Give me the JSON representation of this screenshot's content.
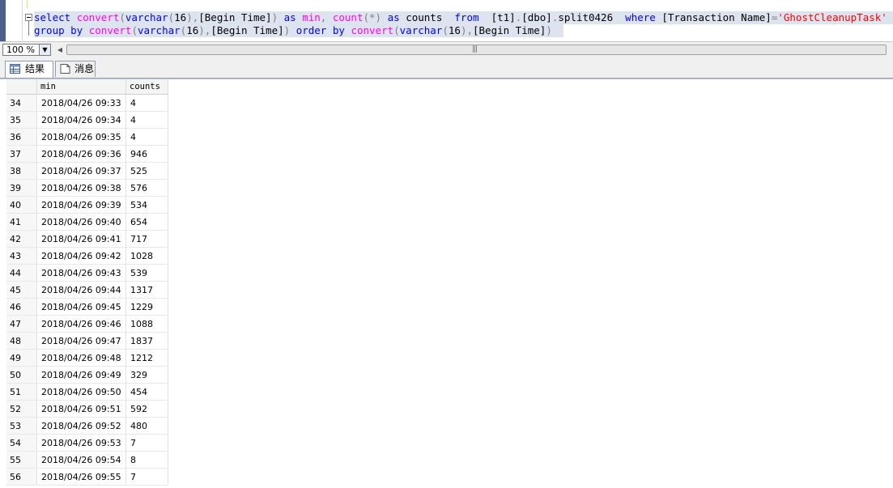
{
  "editor": {
    "line1": [
      {
        "c": "kw",
        "t": "select"
      },
      {
        "c": "tx",
        "t": " "
      },
      {
        "c": "fn",
        "t": "convert"
      },
      {
        "c": "gr",
        "t": "("
      },
      {
        "c": "kw",
        "t": "varchar"
      },
      {
        "c": "gr",
        "t": "("
      },
      {
        "c": "tx",
        "t": "16"
      },
      {
        "c": "gr",
        "t": "),"
      },
      {
        "c": "tx",
        "t": "[Begin Time]"
      },
      {
        "c": "gr",
        "t": ")"
      },
      {
        "c": "tx",
        "t": " "
      },
      {
        "c": "kw",
        "t": "as"
      },
      {
        "c": "tx",
        "t": " "
      },
      {
        "c": "fn",
        "t": "min"
      },
      {
        "c": "gr",
        "t": ","
      },
      {
        "c": "tx",
        "t": " "
      },
      {
        "c": "fn",
        "t": "count"
      },
      {
        "c": "gr",
        "t": "(*)"
      },
      {
        "c": "tx",
        "t": " "
      },
      {
        "c": "kw",
        "t": "as"
      },
      {
        "c": "tx",
        "t": " counts  "
      },
      {
        "c": "kw",
        "t": "from"
      },
      {
        "c": "tx",
        "t": "  [t1]"
      },
      {
        "c": "gr",
        "t": "."
      },
      {
        "c": "tx",
        "t": "[dbo]"
      },
      {
        "c": "gr",
        "t": "."
      },
      {
        "c": "tx",
        "t": "split0426  "
      },
      {
        "c": "kw",
        "t": "where"
      },
      {
        "c": "tx",
        "t": " [Transaction Name]"
      },
      {
        "c": "gr",
        "t": "="
      },
      {
        "c": "str",
        "t": "'GhostCleanupTask'"
      }
    ],
    "line2": [
      {
        "c": "kw",
        "t": "group by"
      },
      {
        "c": "tx",
        "t": " "
      },
      {
        "c": "fn",
        "t": "convert"
      },
      {
        "c": "gr",
        "t": "("
      },
      {
        "c": "kw",
        "t": "varchar"
      },
      {
        "c": "gr",
        "t": "("
      },
      {
        "c": "tx",
        "t": "16"
      },
      {
        "c": "gr",
        "t": "),"
      },
      {
        "c": "tx",
        "t": "[Begin Time]"
      },
      {
        "c": "gr",
        "t": ")"
      },
      {
        "c": "tx",
        "t": " "
      },
      {
        "c": "kw",
        "t": "order by"
      },
      {
        "c": "tx",
        "t": " "
      },
      {
        "c": "fn",
        "t": "convert"
      },
      {
        "c": "gr",
        "t": "("
      },
      {
        "c": "kw",
        "t": "varchar"
      },
      {
        "c": "gr",
        "t": "("
      },
      {
        "c": "tx",
        "t": "16"
      },
      {
        "c": "gr",
        "t": "),"
      },
      {
        "c": "tx",
        "t": "[Begin Time]"
      },
      {
        "c": "gr",
        "t": ")"
      }
    ]
  },
  "zoom": {
    "value": "100 %"
  },
  "scrollbar": {
    "grip": "|||"
  },
  "tabs": {
    "results": "结果",
    "messages": "消息"
  },
  "grid": {
    "columns": [
      "min",
      "counts"
    ],
    "rows": [
      [
        "34",
        "2018/04/26 09:33",
        "4"
      ],
      [
        "35",
        "2018/04/26 09:34",
        "4"
      ],
      [
        "36",
        "2018/04/26 09:35",
        "4"
      ],
      [
        "37",
        "2018/04/26 09:36",
        "946"
      ],
      [
        "38",
        "2018/04/26 09:37",
        "525"
      ],
      [
        "39",
        "2018/04/26 09:38",
        "576"
      ],
      [
        "40",
        "2018/04/26 09:39",
        "534"
      ],
      [
        "41",
        "2018/04/26 09:40",
        "654"
      ],
      [
        "42",
        "2018/04/26 09:41",
        "717"
      ],
      [
        "43",
        "2018/04/26 09:42",
        "1028"
      ],
      [
        "44",
        "2018/04/26 09:43",
        "539"
      ],
      [
        "45",
        "2018/04/26 09:44",
        "1317"
      ],
      [
        "46",
        "2018/04/26 09:45",
        "1229"
      ],
      [
        "47",
        "2018/04/26 09:46",
        "1088"
      ],
      [
        "48",
        "2018/04/26 09:47",
        "1837"
      ],
      [
        "49",
        "2018/04/26 09:48",
        "1212"
      ],
      [
        "50",
        "2018/04/26 09:49",
        "329"
      ],
      [
        "51",
        "2018/04/26 09:50",
        "454"
      ],
      [
        "52",
        "2018/04/26 09:51",
        "592"
      ],
      [
        "53",
        "2018/04/26 09:52",
        "480"
      ],
      [
        "54",
        "2018/04/26 09:53",
        "7"
      ],
      [
        "55",
        "2018/04/26 09:54",
        "8"
      ],
      [
        "56",
        "2018/04/26 09:55",
        "7"
      ]
    ]
  },
  "colors": {
    "keyword": "#0000ff",
    "function": "#ff00ff",
    "operator": "#808080",
    "string": "#ff0000",
    "selection": "#dde4ef"
  }
}
